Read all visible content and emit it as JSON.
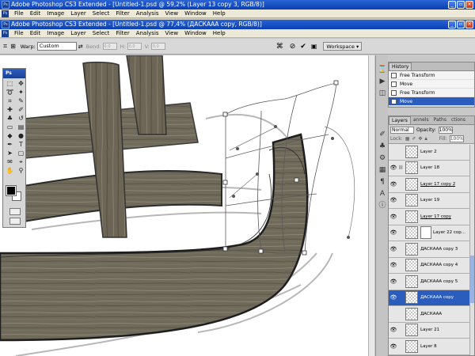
{
  "window1": {
    "title": "Adobe Photoshop CS3 Extended - [Untitled-1.psd @ 59,2% (Layer 13 copy 3, RGB/8)]"
  },
  "window2": {
    "title": "Adobe Photoshop CS3 Extended - [Untitled-1.psd @ 77,4% (ДАСКААА copy, RGB/8)]"
  },
  "menu": [
    "File",
    "Edit",
    "Image",
    "Layer",
    "Select",
    "Filter",
    "Analysis",
    "View",
    "Window",
    "Help"
  ],
  "options": {
    "warp_label": "Warp:",
    "warp_value": "Custom",
    "bend_label": "Bend:",
    "bend_value": "0,0",
    "h_label": "H:",
    "h_value": "0,0",
    "v_label": "V:",
    "v_value": "0,0",
    "workspace_label": "Workspace ▾"
  },
  "toolbox": {
    "header": "Ps"
  },
  "history": {
    "tabs": [
      "History"
    ],
    "items": [
      {
        "label": "Free Transform",
        "selected": false
      },
      {
        "label": "Move",
        "selected": false
      },
      {
        "label": "Free Transform",
        "selected": false
      },
      {
        "label": "Move",
        "selected": true
      }
    ]
  },
  "layers_panel": {
    "tabs": [
      "Layers",
      "annels",
      "Paths",
      "ctions"
    ],
    "blend_mode": "Normal",
    "opacity_label": "Opacity:",
    "opacity_value": "100%",
    "lock_label": "Lock:",
    "fill_label": "Fill:",
    "fill_value": "100%",
    "layers": [
      {
        "name": "Layer 2",
        "visible": false,
        "selected": false
      },
      {
        "name": "Layer 18",
        "visible": true,
        "selected": false
      },
      {
        "name": "Layer 17 copy 2",
        "visible": true,
        "selected": false
      },
      {
        "name": "Layer 19",
        "visible": true,
        "selected": false
      },
      {
        "name": "Layer 17 copy",
        "visible": true,
        "selected": false
      },
      {
        "name": "Layer 22 cop...",
        "visible": true,
        "selected": false,
        "has_mask": true
      },
      {
        "name": "ДАСКААА copy 3",
        "visible": true,
        "selected": false
      },
      {
        "name": "ДАСКААА copy 4",
        "visible": true,
        "selected": false
      },
      {
        "name": "ДАСКААА copy 5",
        "visible": true,
        "selected": false
      },
      {
        "name": "ДАСКААА copy",
        "visible": true,
        "selected": true
      },
      {
        "name": "ДАСКААА",
        "visible": false,
        "selected": false
      },
      {
        "name": "Layer 21",
        "visible": true,
        "selected": false
      },
      {
        "name": "Layer 8",
        "visible": true,
        "selected": false
      }
    ]
  }
}
